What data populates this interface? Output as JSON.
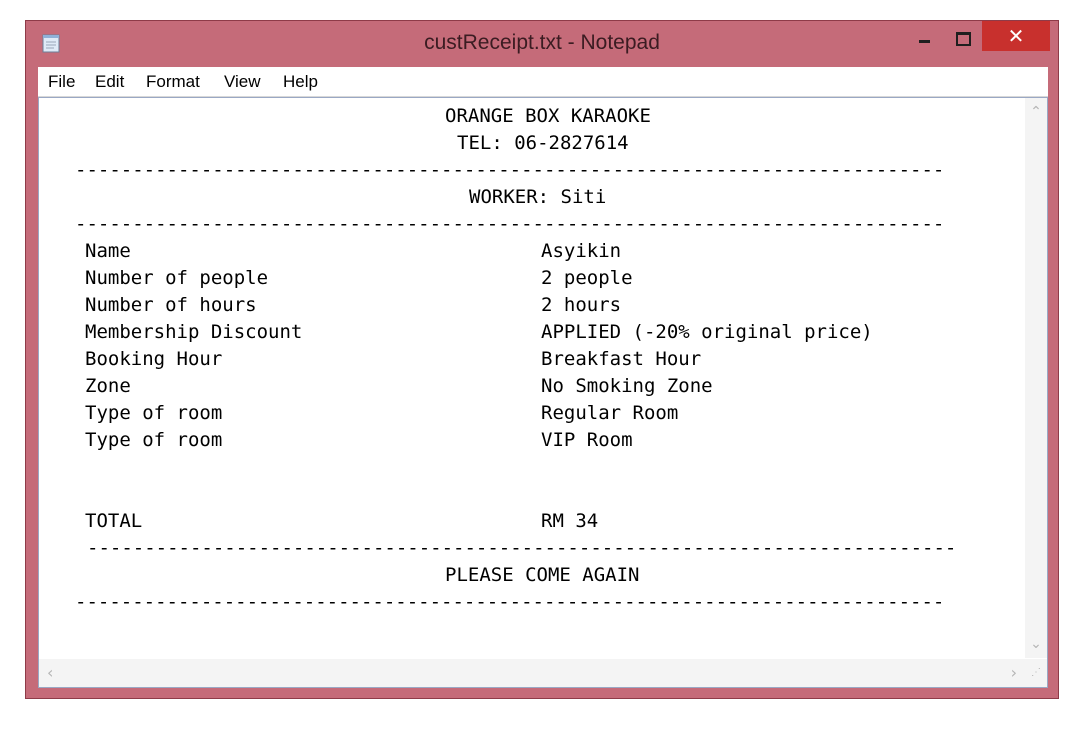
{
  "window": {
    "title": "custReceipt.txt - Notepad",
    "close_glyph": "✕",
    "colors": {
      "frame": "#c56b79",
      "close": "#c8302d"
    }
  },
  "menu": [
    "File",
    "Edit",
    "Format",
    "View",
    "Help"
  ],
  "receipt": {
    "header": "ORANGE BOX KARAOKE",
    "tel": "TEL: 06-2827614",
    "rule_a": "----------------------------------------------------------------------------",
    "worker": "WORKER: Siti",
    "rule_b": "----------------------------------------------------------------------------",
    "rows": [
      {
        "label": "Name",
        "value": "Asyikin"
      },
      {
        "label": "Number of people",
        "value": "2 people"
      },
      {
        "label": "Number of hours",
        "value": "2 hours"
      },
      {
        "label": "Membership Discount",
        "value": "APPLIED (-20% original price)"
      },
      {
        "label": "Booking Hour",
        "value": "Breakfast Hour"
      },
      {
        "label": "Zone",
        "value": "No Smoking Zone"
      },
      {
        "label": "Type of room",
        "value": "Regular Room"
      },
      {
        "label": "Type of room",
        "value": "VIP Room"
      }
    ],
    "total_label": "TOTAL",
    "total_value": "RM 34",
    "rule_c": "----------------------------------------------------------------------------",
    "footer": "PLEASE COME AGAIN",
    "rule_d": "----------------------------------------------------------------------------"
  },
  "icons": [
    "notepad-icon",
    "minimize-icon",
    "maximize-icon",
    "close-icon",
    "scroll-up-icon",
    "scroll-down-icon",
    "scroll-left-icon",
    "scroll-right-icon",
    "resize-grip-icon"
  ]
}
